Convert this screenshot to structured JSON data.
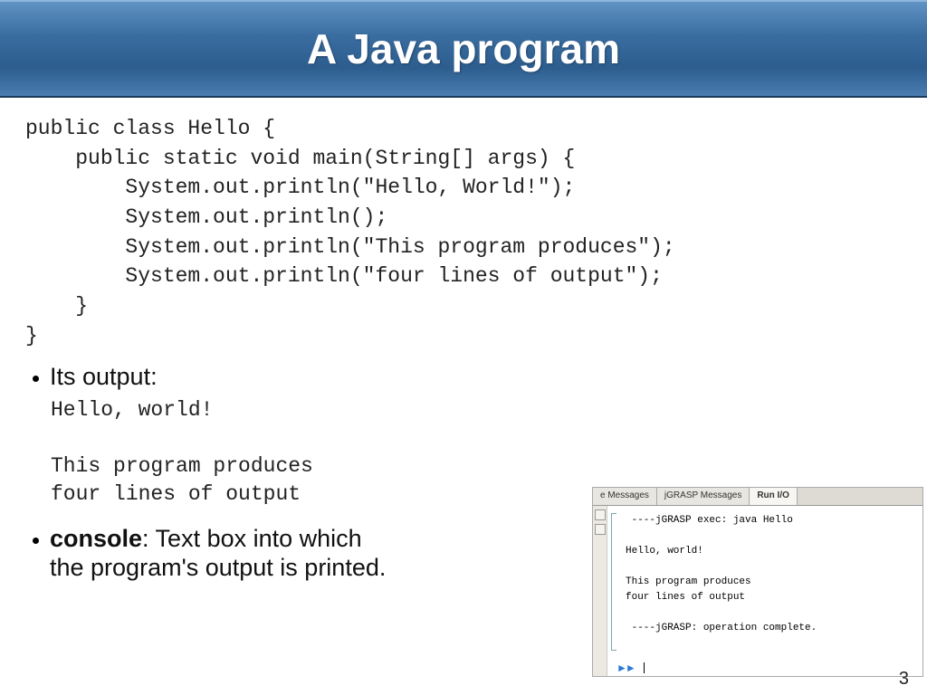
{
  "title": "A Java program",
  "code": "public class Hello {\n    public static void main(String[] args) {\n        System.out.println(\"Hello, World!\");\n        System.out.println();\n        System.out.println(\"This program produces\");\n        System.out.println(\"four lines of output\");\n    }\n}",
  "bullet1": "Its output:",
  "output": "Hello, world!\n\nThis program produces\nfour lines of output",
  "bullet2_strong": "console",
  "bullet2_rest": ": Text box into which\nthe program's output is printed.",
  "console": {
    "tabs": [
      "e Messages",
      "jGRASP Messages",
      "Run I/O"
    ],
    "active_tab": 2,
    "text": " ----jGRASP exec: java Hello\n\nHello, world!\n\nThis program produces\nfour lines of output\n\n ----jGRASP: operation complete."
  },
  "page_number": "3"
}
